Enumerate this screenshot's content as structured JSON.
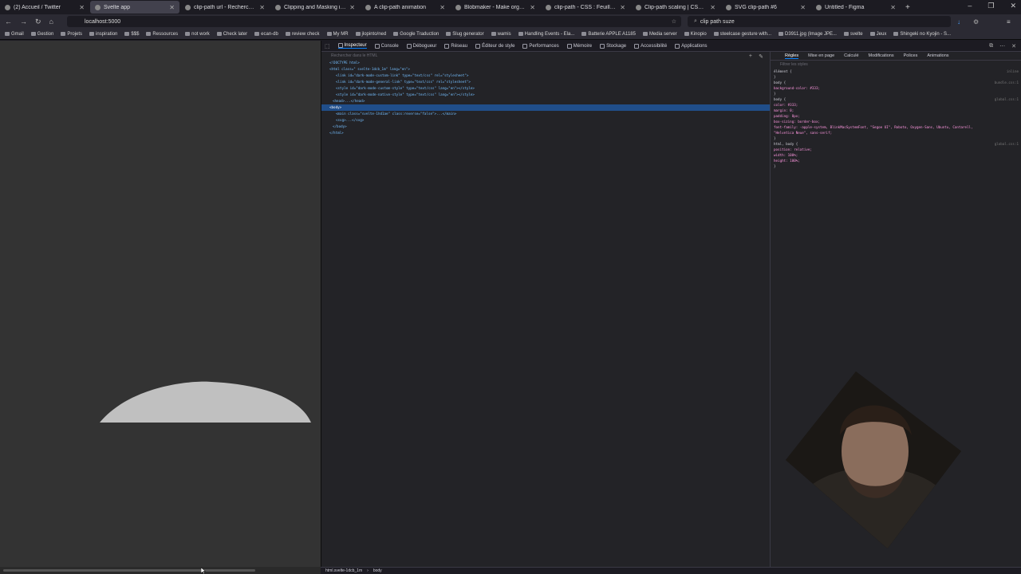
{
  "tabs": [
    {
      "title": "(2) Accueil / Twitter",
      "active": false
    },
    {
      "title": "Svelte app",
      "active": true
    },
    {
      "title": "clip-path url - Recherche Goo",
      "active": false
    },
    {
      "title": "Clipping and Masking in CSS",
      "active": false
    },
    {
      "title": "A clip-path animation",
      "active": false
    },
    {
      "title": "Blobmaker - Make organic SV",
      "active": false
    },
    {
      "title": "clip-path - CSS : Feuilles de st",
      "active": false
    },
    {
      "title": "Clip-path scaling | CSS For De",
      "active": false
    },
    {
      "title": "SVG clip-path #6",
      "active": false
    },
    {
      "title": "Untitled - Figma",
      "active": false
    }
  ],
  "url": "localhost:5000",
  "search_value": "clip path suze",
  "bookmarks": [
    "Gmail",
    "Gestion",
    "Projets",
    "inspiration",
    "$$$",
    "Ressources",
    "not work",
    "Check later",
    "ecan-db",
    "review check",
    "My MR",
    "jlopinto/ned",
    "Google Traduction",
    "Slug generator",
    "wamis",
    "Handling Events - Ela...",
    "Batterie APPLE A1185",
    "Media server",
    "Kinopio",
    "steelcase gesture with...",
    "D3911.jpg (Image JPE...",
    "svelte",
    "Jeux",
    "Shingeki no Kyojin - S..."
  ],
  "devtools": {
    "tabs": [
      "Inspecteur",
      "Console",
      "Débogueur",
      "Réseau",
      "Éditeur de style",
      "Performances",
      "Mémoire",
      "Stockage",
      "Accessibilité",
      "Applications"
    ],
    "search_placeholder": "Rechercher dans le HTML",
    "markup": [
      "<!DOCTYPE html>",
      "<html class=\" svelte-1dcb_1m\" lang=\"en\">",
      "<link id=\"dark-mode-custom-link\" type=\"text/css\" rel=\"stylesheet\">",
      "<link id=\"dark-mode-general-link\" type=\"text/css\" rel=\"stylesheet\">",
      "<style id=\"dark-mode-custom-style\" type=\"text/css\" lang=\"en\"></style>",
      "<style id=\"dark-mode-native-style\" type=\"text/css\" lang=\"en\"></style>",
      "<head>...</head>",
      "<body>",
      "<main class=\"svelte-1hd1ae\" class:reverse=\"false\">...</main>",
      "<svg>...</svg>",
      "</body>",
      "</html>"
    ],
    "rules_tabs": [
      "Règles",
      "Mise en page",
      "Calculé",
      "Modifications",
      "Polices",
      "Animations"
    ],
    "filter_placeholder": "Filtrer les styles",
    "rules": [
      "élément {",
      "}",
      "body {",
      "  background-color: #333;",
      "}",
      "body {",
      "  color: #333;",
      "  margin: 0;",
      "  padding: 8px;",
      "  box-sizing: border-box;",
      "  font-family: -apple-system, BlinkMacSystemFont, \"Segoe UI\", Roboto, Oxygen-Sans, Ubuntu, Cantarell,",
      "    \"Helvetica Neue\", sans-serif;",
      "}",
      "html, body {",
      "  position: relative;",
      "  width: 100%;",
      "  height: 100%;",
      "}"
    ],
    "rule_sources": [
      "inline",
      "bundle.css:1",
      "global.css:1",
      "global.css:1"
    ],
    "breadcrumbs": [
      "html.svelte-1dcb_1m",
      "body"
    ]
  },
  "colors": {
    "viewport_bg": "#333333",
    "shape_fill": "#c0c0c0",
    "selection": "#204e8a",
    "accent": "#0a84ff"
  }
}
